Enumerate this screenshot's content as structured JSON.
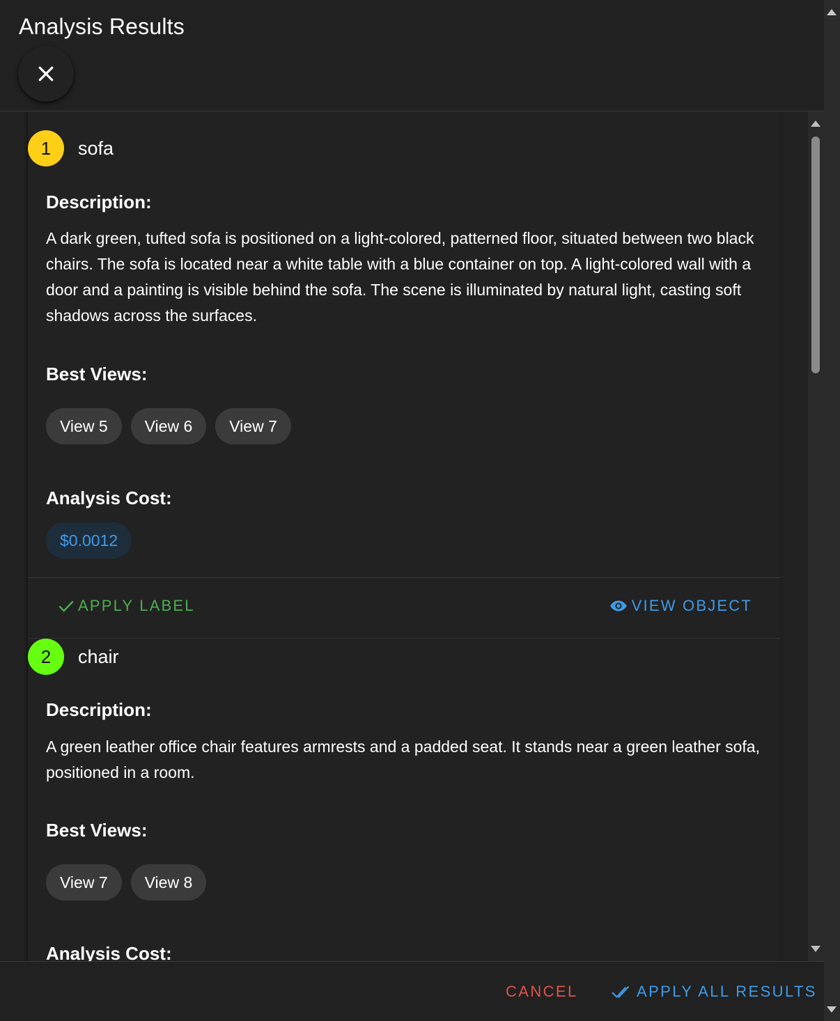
{
  "dialog": {
    "title": "Analysis Results",
    "close_icon": "close-icon"
  },
  "results": [
    {
      "index": "1",
      "badge_color": "#fdd017",
      "label": "sofa",
      "description_heading": "Description:",
      "description": "A dark green, tufted sofa is positioned on a light-colored, patterned floor, situated between two black chairs. The sofa is located near a white table with a blue container on top. A light-colored wall with a door and a painting is visible behind the sofa. The scene is illuminated by natural light, casting soft shadows across the surfaces.",
      "best_views_heading": "Best Views:",
      "views": [
        "View 5",
        "View 6",
        "View 7"
      ],
      "cost_heading": "Analysis Cost:",
      "cost": "$0.0012",
      "apply_label": "APPLY LABEL",
      "view_object": "VIEW OBJECT"
    },
    {
      "index": "2",
      "badge_color": "#66ff12",
      "label": "chair",
      "description_heading": "Description:",
      "description": "A green leather office chair features armrests and a padded seat. It stands near a green leather sofa, positioned in a room.",
      "best_views_heading": "Best Views:",
      "views": [
        "View 7",
        "View 8"
      ],
      "cost_heading": "Analysis Cost:"
    }
  ],
  "footer": {
    "cancel_label": "CANCEL",
    "apply_all_label": "APPLY ALL RESULTS"
  },
  "colors": {
    "background": "#212121",
    "accent_blue": "#3d9be8",
    "accent_green": "#4caf50",
    "cancel_red": "#e0534d"
  }
}
